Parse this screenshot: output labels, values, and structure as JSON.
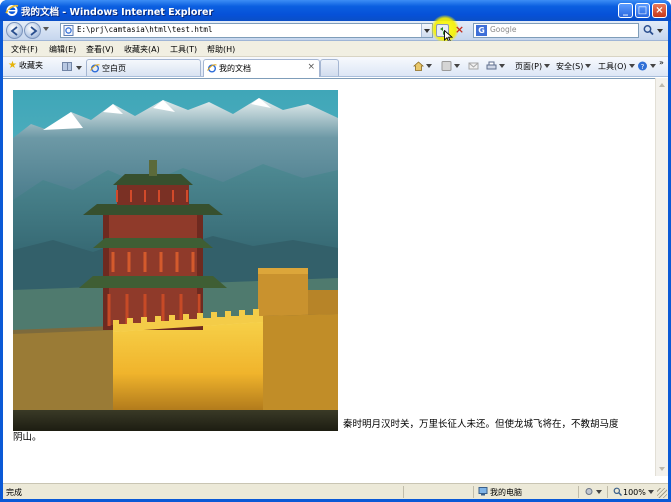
{
  "window": {
    "title": "我的文档 - Windows Internet Explorer",
    "min": "_",
    "max": "□",
    "close": "×"
  },
  "address": {
    "url": "E:\\prj\\camtasia\\html\\test.html"
  },
  "search": {
    "placeholder": "Google",
    "logo": "G"
  },
  "menu": {
    "items": [
      "文件(F)",
      "编辑(E)",
      "查看(V)",
      "收藏夹(A)",
      "工具(T)",
      "帮助(H)"
    ]
  },
  "tabs": {
    "favorites_label": "收藏夹",
    "items": [
      {
        "label": "空白页",
        "active": false
      },
      {
        "label": "我的文档",
        "active": true
      }
    ],
    "close": "×"
  },
  "toolbar": {
    "page_label": "页面(P)",
    "safety_label": "安全(S)",
    "tools_label": "工具(O)",
    "more": "»"
  },
  "content": {
    "poem_line1": "秦时明月汉时关，万里长征人未还。但使龙城飞将在，不教胡马度",
    "poem_line2": "阴山。"
  },
  "status": {
    "text": "完成",
    "zone": "我的电脑",
    "zoom": "100%"
  },
  "colors": {
    "title_blue": "#0b5fe0",
    "highlight": "#f5f000"
  }
}
